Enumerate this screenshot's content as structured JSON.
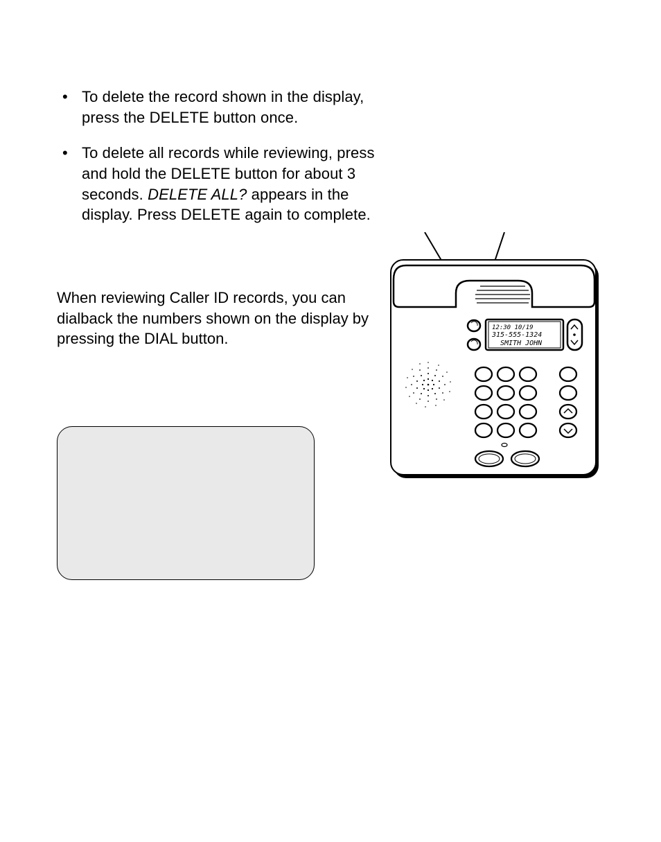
{
  "bullets": {
    "b1": "To delete the record shown in the display, press the DELETE button once.",
    "b2_a": "To delete all records while reviewing, press and hold the DELETE button for about 3 seconds. ",
    "b2_i": "DELETE ALL?",
    "b2_b": " appears in the display. Press DELETE again to complete."
  },
  "para": "When reviewing Caller ID records, you can dialback the numbers shown on the display by pressing the DIAL button.",
  "lcd": {
    "line1": "12:30  10/19",
    "line2": "315-555-1324",
    "line3": "SMITH JOHN"
  }
}
